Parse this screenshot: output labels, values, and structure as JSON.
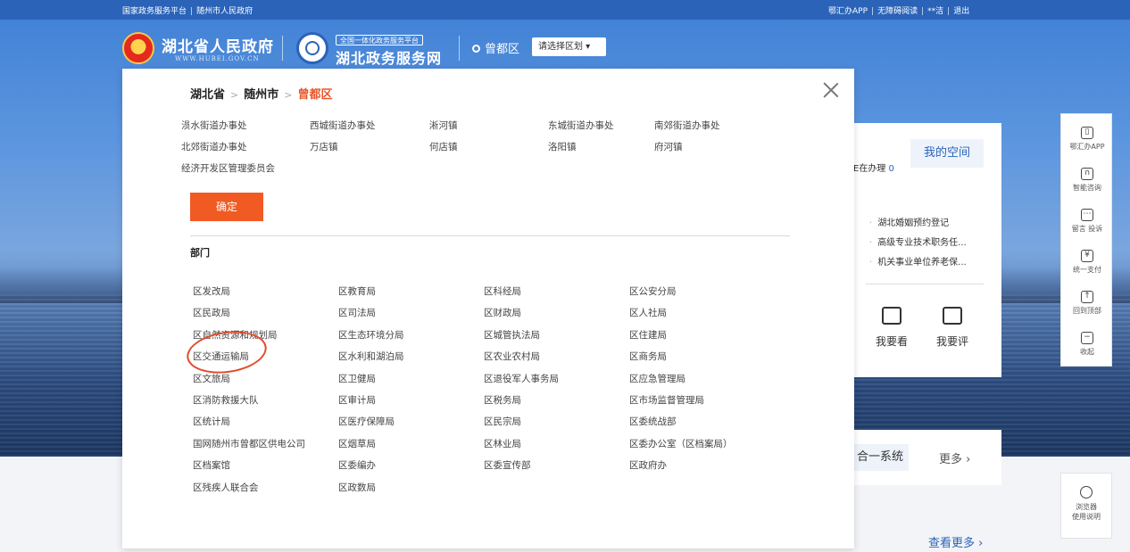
{
  "topbar": {
    "left": [
      "国家政务服务平台",
      "随州市人民政府"
    ],
    "right": [
      "鄂汇办APP",
      "无障碍阅读",
      "**洁",
      "退出"
    ]
  },
  "header": {
    "site_title": "湖北省人民政府",
    "site_sub": "WWW.HUBEI.GOV.CN",
    "badge": "全国一体化政务服务平台",
    "service_title": "湖北政务服务网",
    "location": "曾都区",
    "region_select": "请选择区划 ▾"
  },
  "space_card": {
    "in_process": "E在办理",
    "in_process_count": "0",
    "my_space": "我的空间",
    "services": [
      "湖北婚姻预约登记",
      "高级专业技术职务任...",
      "机关事业单位养老保..."
    ],
    "actions": [
      "我要看",
      "我要评"
    ]
  },
  "sys_card": {
    "chip": "合一系统",
    "more": "更多 ›"
  },
  "see_more": "查看更多 ›",
  "toolbar": [
    {
      "label": "鄂汇办APP",
      "glyph": "▯"
    },
    {
      "label": "智能咨询",
      "glyph": "∩"
    },
    {
      "label": "留言 投诉",
      "glyph": "⋯"
    },
    {
      "label": "统一支付",
      "glyph": "¥"
    },
    {
      "label": "回到顶部",
      "glyph": "↑"
    },
    {
      "label": "收起",
      "glyph": "−"
    }
  ],
  "browser_help": [
    "浏览器",
    "使用说明"
  ],
  "modal": {
    "crumb": [
      "湖北省",
      "随州市",
      "曾都区"
    ],
    "streets": [
      [
        "涢水街道办事处",
        "西城街道办事处",
        "淅河镇",
        "东城街道办事处",
        "南郊街道办事处"
      ],
      [
        "北郊街道办事处",
        "万店镇",
        "何店镇",
        "洛阳镇",
        "府河镇"
      ],
      [
        "经济开发区管理委员会"
      ]
    ],
    "confirm": "确定",
    "dept_heading": "部门",
    "departments": [
      [
        "区发改局",
        "区教育局",
        "区科经局",
        "区公安分局"
      ],
      [
        "区民政局",
        "区司法局",
        "区财政局",
        "区人社局"
      ],
      [
        "区自然资源和规划局",
        "区生态环境分局",
        "区城管执法局",
        "区住建局"
      ],
      [
        "区交通运输局",
        "区水利和湖泊局",
        "区农业农村局",
        "区商务局"
      ],
      [
        "区文旅局",
        "区卫健局",
        "区退役军人事务局",
        "区应急管理局"
      ],
      [
        "区消防救援大队",
        "区审计局",
        "区税务局",
        "区市场监督管理局"
      ],
      [
        "区统计局",
        "区医疗保障局",
        "区民宗局",
        "区委统战部"
      ],
      [
        "国网随州市曾都区供电公司",
        "区烟草局",
        "区林业局",
        "区委办公室（区档案局）"
      ],
      [
        "区档案馆",
        "区委编办",
        "区委宣传部",
        "区政府办"
      ],
      [
        "区残疾人联合会",
        "区政数局"
      ]
    ]
  }
}
